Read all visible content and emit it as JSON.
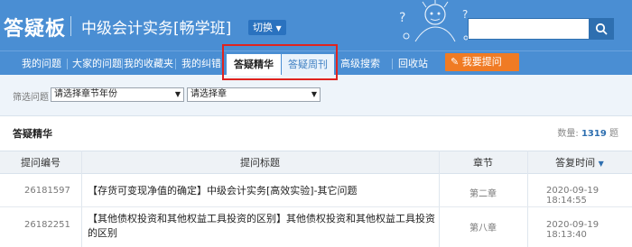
{
  "header": {
    "logo": "答疑板",
    "course": "中级会计实务[畅学班]",
    "switch_label": "切换",
    "search": {
      "placeholder": ""
    }
  },
  "nav": {
    "items": [
      {
        "label": "我的问题"
      },
      {
        "label": "大家的问题"
      },
      {
        "label": "我的收藏夹"
      },
      {
        "label": "我的纠错"
      },
      {
        "label": "答疑精华"
      },
      {
        "label": "答疑周刊"
      },
      {
        "label": "高级搜索"
      },
      {
        "label": "回收站"
      }
    ],
    "ask_button": "我要提问"
  },
  "filter": {
    "label": "筛选问题",
    "select1": "请选择章节年份",
    "select2": "请选择章"
  },
  "panel": {
    "title": "答疑精华",
    "count_label": "数量:",
    "count_value": "1319",
    "count_unit": "题"
  },
  "table": {
    "headers": [
      "提问编号",
      "提问标题",
      "章节",
      "答复时间"
    ],
    "rows": [
      {
        "id": "26181597",
        "title": "【存货可变现净值的确定】中级会计实务[高效实验]-其它问题",
        "chapter": "第二章",
        "time": "2020-09-19 18:14:55"
      },
      {
        "id": "26182251",
        "title": "【其他债权投资和其他权益工具投资的区别】其他债权投资和其他权益工具投资的区别",
        "chapter": "第八章",
        "time": "2020-09-19 18:13:40"
      }
    ]
  },
  "colors": {
    "header": "#4a8ed3",
    "ask": "#f07b24",
    "highlight": "#e0231e"
  }
}
